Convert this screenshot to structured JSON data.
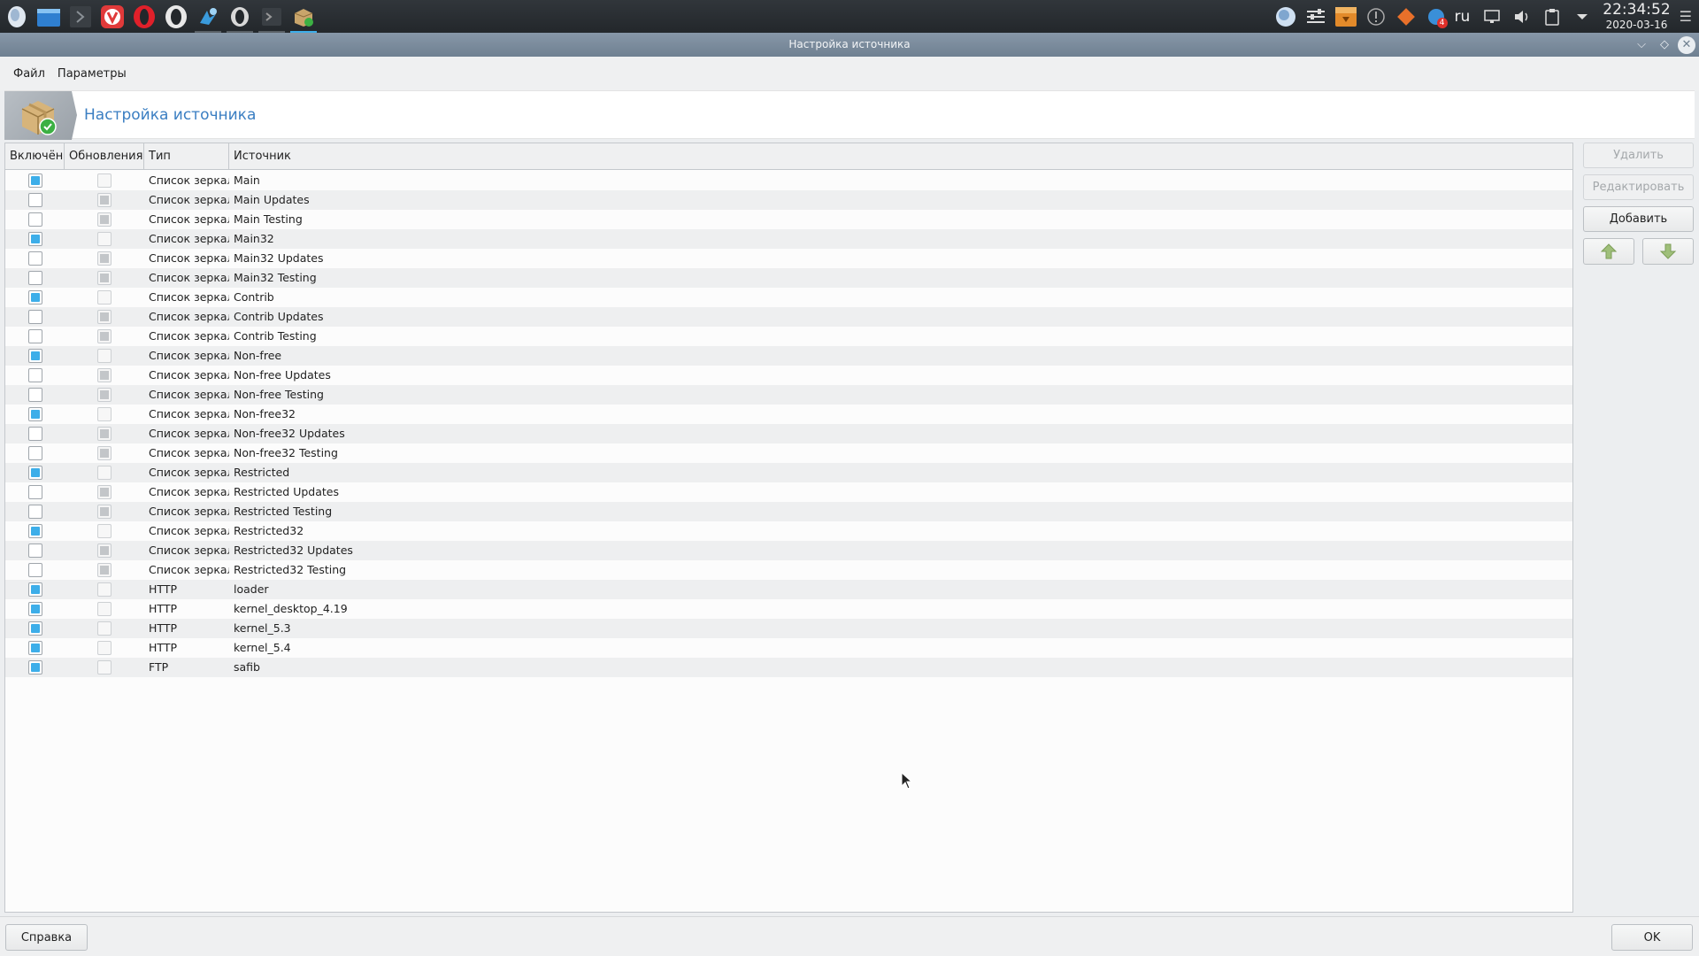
{
  "taskbar": {
    "launchers": [
      {
        "icon": "start-menu-icon"
      },
      {
        "icon": "file-manager-icon"
      },
      {
        "icon": "terminal-icon"
      },
      {
        "icon": "vivaldi-icon"
      },
      {
        "icon": "opera-icon"
      },
      {
        "icon": "opera-dark-icon"
      },
      {
        "icon": "pinned-app-icon"
      },
      {
        "icon": "opera-window-icon"
      },
      {
        "icon": "terminal-window-icon"
      },
      {
        "icon": "package-manager-icon"
      }
    ],
    "tray": {
      "lang": "ru",
      "notification_count": "4",
      "time": "22:34:52",
      "date": "2020-03-16"
    }
  },
  "window": {
    "title": "Настройка источника",
    "menu": [
      "Файл",
      "Параметры"
    ],
    "header_title": "Настройка источника"
  },
  "table": {
    "columns": [
      "Включён",
      "Обновления",
      "Тип",
      "Источник"
    ],
    "rows": [
      {
        "enabled": true,
        "updates": "disabled",
        "type": "Список зеркал",
        "source": "Main"
      },
      {
        "enabled": false,
        "updates": "partial",
        "type": "Список зеркал",
        "source": "Main Updates"
      },
      {
        "enabled": false,
        "updates": "partial",
        "type": "Список зеркал",
        "source": "Main Testing"
      },
      {
        "enabled": true,
        "updates": "disabled",
        "type": "Список зеркал",
        "source": "Main32"
      },
      {
        "enabled": false,
        "updates": "partial",
        "type": "Список зеркал",
        "source": "Main32 Updates"
      },
      {
        "enabled": false,
        "updates": "partial",
        "type": "Список зеркал",
        "source": "Main32 Testing"
      },
      {
        "enabled": true,
        "updates": "disabled",
        "type": "Список зеркал",
        "source": "Contrib"
      },
      {
        "enabled": false,
        "updates": "partial",
        "type": "Список зеркал",
        "source": "Contrib Updates"
      },
      {
        "enabled": false,
        "updates": "partial",
        "type": "Список зеркал",
        "source": "Contrib Testing"
      },
      {
        "enabled": true,
        "updates": "disabled",
        "type": "Список зеркал",
        "source": "Non-free"
      },
      {
        "enabled": false,
        "updates": "partial",
        "type": "Список зеркал",
        "source": "Non-free Updates"
      },
      {
        "enabled": false,
        "updates": "partial",
        "type": "Список зеркал",
        "source": "Non-free Testing"
      },
      {
        "enabled": true,
        "updates": "disabled",
        "type": "Список зеркал",
        "source": "Non-free32"
      },
      {
        "enabled": false,
        "updates": "partial",
        "type": "Список зеркал",
        "source": "Non-free32 Updates"
      },
      {
        "enabled": false,
        "updates": "partial",
        "type": "Список зеркал",
        "source": "Non-free32 Testing"
      },
      {
        "enabled": true,
        "updates": "disabled",
        "type": "Список зеркал",
        "source": "Restricted"
      },
      {
        "enabled": false,
        "updates": "partial",
        "type": "Список зеркал",
        "source": "Restricted Updates"
      },
      {
        "enabled": false,
        "updates": "partial",
        "type": "Список зеркал",
        "source": "Restricted Testing"
      },
      {
        "enabled": true,
        "updates": "disabled",
        "type": "Список зеркал",
        "source": "Restricted32"
      },
      {
        "enabled": false,
        "updates": "partial",
        "type": "Список зеркал",
        "source": "Restricted32 Updates"
      },
      {
        "enabled": false,
        "updates": "partial",
        "type": "Список зеркал",
        "source": "Restricted32 Testing"
      },
      {
        "enabled": true,
        "updates": "disabled",
        "type": "HTTP",
        "source": "loader"
      },
      {
        "enabled": true,
        "updates": "disabled",
        "type": "HTTP",
        "source": "kernel_desktop_4.19"
      },
      {
        "enabled": true,
        "updates": "disabled",
        "type": "HTTP",
        "source": "kernel_5.3"
      },
      {
        "enabled": true,
        "updates": "disabled",
        "type": "HTTP",
        "source": "kernel_5.4"
      },
      {
        "enabled": true,
        "updates": "disabled",
        "type": "FTP",
        "source": "safib"
      }
    ]
  },
  "side_buttons": {
    "delete": "Удалить",
    "edit": "Редактировать",
    "add": "Добавить"
  },
  "bottom": {
    "help": "Справка",
    "ok": "OK"
  },
  "colors": {
    "accent": "#3daee9",
    "header_title": "#3a7ec2",
    "titlebar": "#7b8b9c"
  }
}
